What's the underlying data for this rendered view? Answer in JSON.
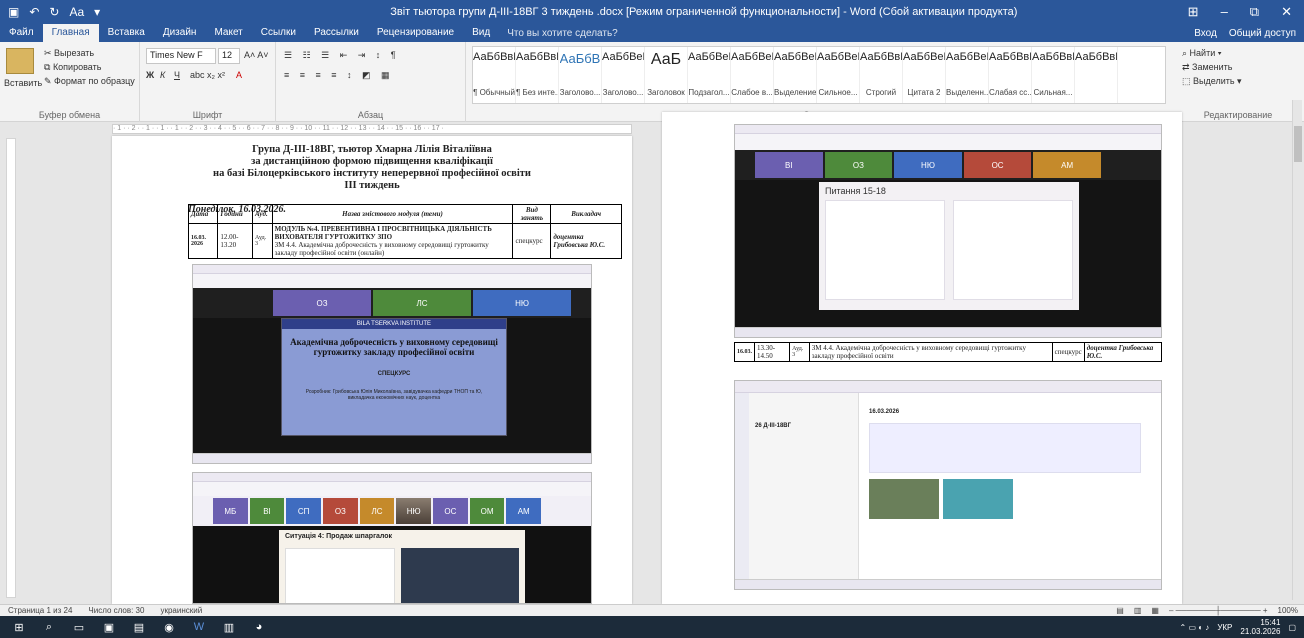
{
  "window": {
    "title": "Звіт тьютора групи Д-ІІІ-18ВГ 3 тиждень .docx [Режим ограниченной функциональности] - Word (Сбой активации продукта)",
    "account": "Вход",
    "share": "Общий доступ"
  },
  "tabs": [
    "Файл",
    "Главная",
    "Вставка",
    "Дизайн",
    "Макет",
    "Ссылки",
    "Рассылки",
    "Рецензирование",
    "Вид"
  ],
  "tellme": "Что вы хотите сделать?",
  "ribbon": {
    "clipboard": {
      "label": "Буфер обмена",
      "paste": "Вставить",
      "cut": "Вырезать",
      "copy": "Копировать",
      "format": "Формат по образцу"
    },
    "font": {
      "label": "Шрифт",
      "name": "Times New F",
      "size": "12"
    },
    "paragraph": {
      "label": "Абзац"
    },
    "styles": {
      "label": "Стили",
      "items": [
        {
          "sample": "АаБбВвГг,",
          "name": "¶ Обычный"
        },
        {
          "sample": "АаБбВвГг,",
          "name": "¶ Без инте..."
        },
        {
          "sample": "АаБбВ",
          "name": "Заголово..."
        },
        {
          "sample": "АаБбВеГ",
          "name": "Заголово..."
        },
        {
          "sample": "АаБ",
          "name": "Заголовок"
        },
        {
          "sample": "АаБбВеГ",
          "name": "Подзагол..."
        },
        {
          "sample": "АаБбВеГг",
          "name": "Слабое в..."
        },
        {
          "sample": "АаБбВеГг",
          "name": "Выделение"
        },
        {
          "sample": "АаБбВеГг",
          "name": "Сильное..."
        },
        {
          "sample": "АаБбВвГг,",
          "name": "Строгий"
        },
        {
          "sample": "АаБбВеГг",
          "name": "Цитата 2"
        },
        {
          "sample": "АаБбВеГг",
          "name": "Выделенн..."
        },
        {
          "sample": "АаБбВвГг",
          "name": "Слабая сс..."
        },
        {
          "sample": "АаБбВвГг,",
          "name": "Сильная..."
        },
        {
          "sample": "АаБбВвГг,",
          "name": ""
        }
      ]
    },
    "editing": {
      "label": "Редактирование",
      "find": "Найти",
      "replace": "Заменить",
      "select": "Выделить"
    }
  },
  "doc": {
    "heading1": "Група Д-ІІІ-18ВГ, тьютор Хмарна Лілія Віталіївна",
    "heading2": "за дистанційною формою підвищення кваліфікації",
    "heading3": "на базі Білоцерківського інституту неперервної професійної освіти",
    "heading4": "ІІІ тиждень",
    "date_line": "Понеділок, 16.03.2026.",
    "table_headers": [
      "Дата",
      "Години",
      "Ауд.",
      "Назва змістового модуля (теми)",
      "Вид занять",
      "Викладач"
    ],
    "row1": {
      "date": "16.03. 2026",
      "hours": "12.00-13.20",
      "aud": "Ауд. 3",
      "module": "МОДУЛЬ №4. ПРЕВЕНТИВНА І ПРОСВІТНИЦЬКА ДІЯЛЬНІСТЬ ВИХОВАТЕЛЯ ГУРТОЖИТКУ ЗПО",
      "topic": "ЗМ 4.4. Академічна доброчесність у виховному середовищі гуртожитку закладу професійної освіти (онлайн)",
      "kind": "спецкурс",
      "teacher": "доцентка Грибовська Ю.С."
    },
    "row2": {
      "date": "16.03.",
      "hours": "13.30-14.50",
      "aud": "Ауд. 3",
      "topic": "ЗМ 4.4. Академічна доброчесність у виховному середовищі гуртожитку закладу професійної освіти",
      "kind": "спецкурс",
      "teacher": "доцентка Грибовська Ю.С."
    },
    "slide_title": "Академічна доброчесність у виховному середовищі гуртожитку закладу професійної освіти",
    "slide_sub": "СПЕЦКУРС",
    "slide_author": "Розробник: Грибовська Юлія Миколаївна, завідувачка кафедри ТНОП та Ю, викладачка економічних наук, доцентка",
    "quiz_title": "Питання 15-18",
    "case_title": "Ситуація 4: Продаж шпаргалок",
    "tiles_a": [
      "ВІ",
      "ОЗ",
      "НЮ",
      "ОС",
      "АМ"
    ],
    "tiles_b": [
      "ОЗ",
      "ЛС",
      "НЮ"
    ],
    "tiles_c": [
      "МБ",
      "ВІ",
      "СП",
      "ОЗ",
      "ЛС",
      "НЮ",
      "ОС",
      "ОМ",
      "АМ"
    ],
    "teams_group": "26 Д-ІІІ-18ВГ",
    "teams_date": "16.03.2026"
  },
  "status": {
    "page": "Страница 1 из 24",
    "words": "Число слов: 30",
    "lang": "украинский",
    "zoom": "100%"
  },
  "tray": {
    "lang": "УКР",
    "time": "15:41",
    "date": "21.03.2026"
  }
}
